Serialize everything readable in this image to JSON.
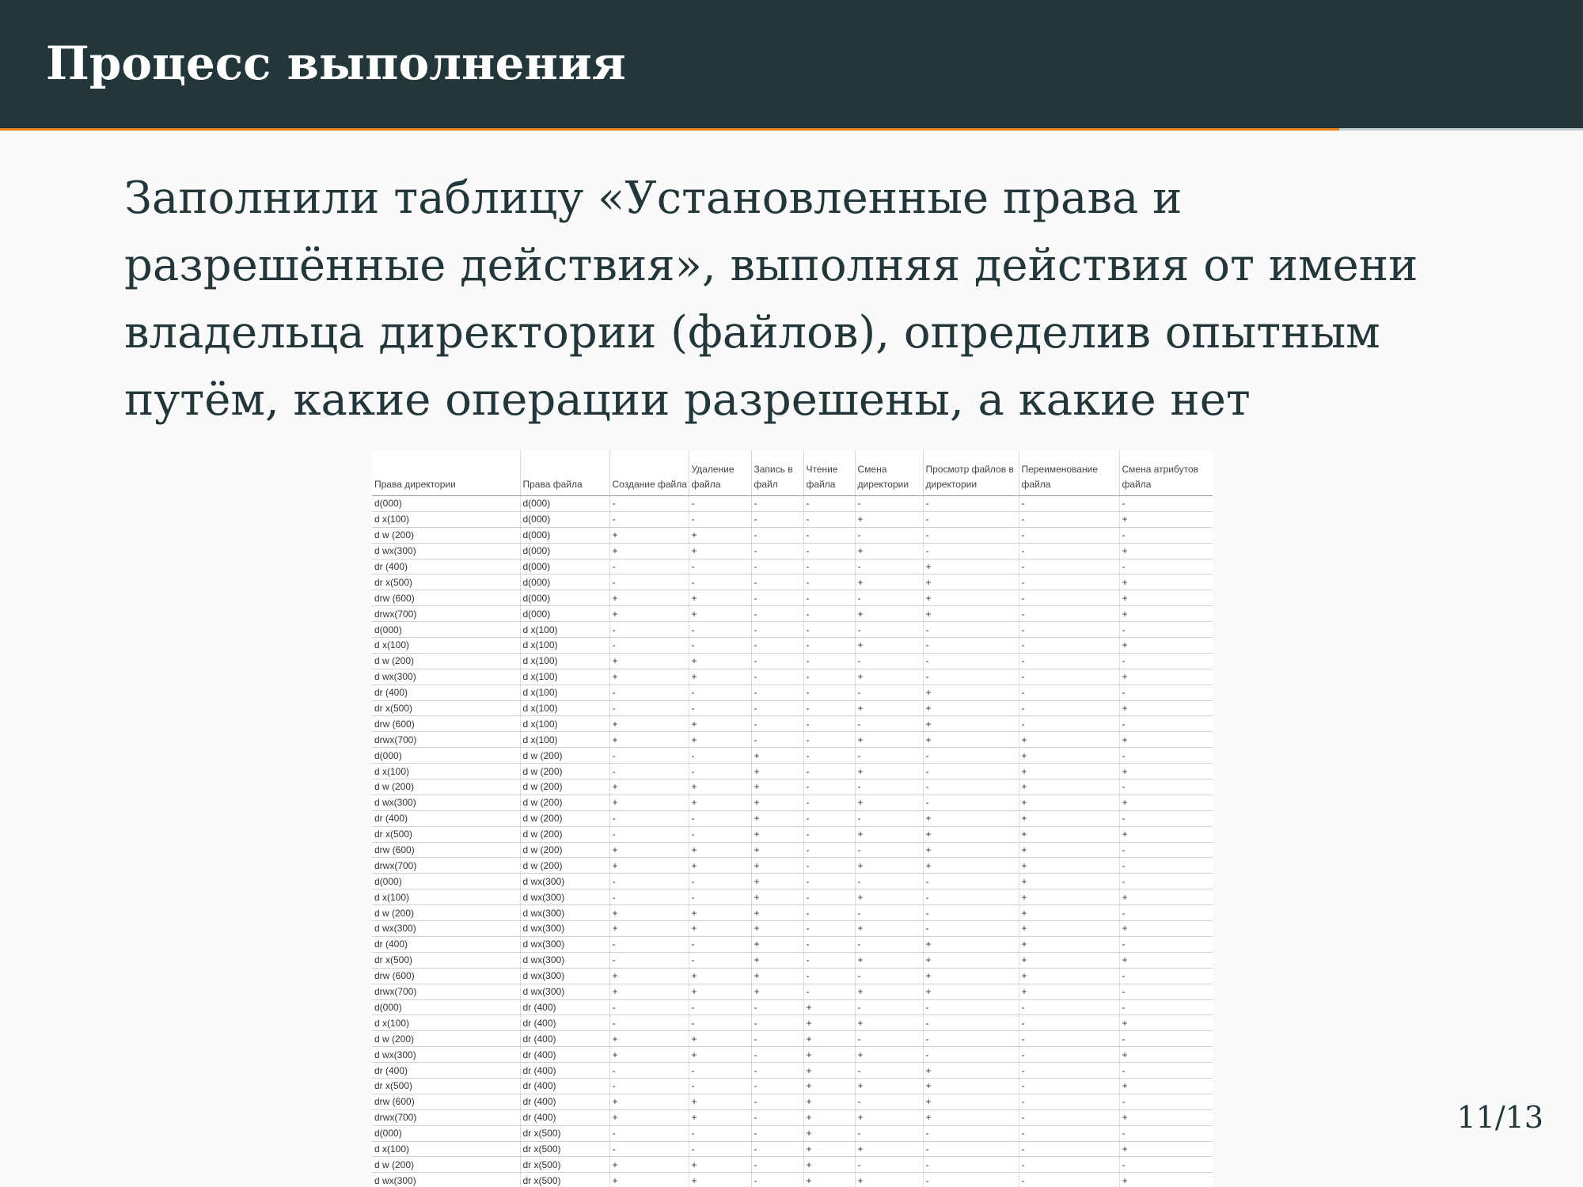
{
  "header": {
    "title": "Процесс выполнения"
  },
  "progress": {
    "fraction": 0.846
  },
  "body": {
    "text": "Заполнили таблицу «Установленные права и разрешённые действия», выполняя действия от имени владельца директории (файлов), определив опытным путём, какие операции разрешены, а какие нет"
  },
  "table": {
    "columns": [
      "Права директории",
      "Права файла",
      "Создание файла",
      "Удаление файла",
      "Запись в файл",
      "Чтение файла",
      "Смена директории",
      "Просмотр файлов в директории",
      "Переименование файла",
      "Смена атрибутов файла"
    ],
    "rows": [
      [
        "d(000)",
        "d(000)",
        "-",
        "-",
        "-",
        "-",
        "-",
        "-",
        "-",
        "-"
      ],
      [
        "d x(100)",
        "d(000)",
        "-",
        "-",
        "-",
        "-",
        "+",
        "-",
        "-",
        "+"
      ],
      [
        "d w (200)",
        "d(000)",
        "+",
        "+",
        "-",
        "-",
        "-",
        "-",
        "-",
        "-"
      ],
      [
        "d wx(300)",
        "d(000)",
        "+",
        "+",
        "-",
        "-",
        "+",
        "-",
        "-",
        "+"
      ],
      [
        "dr (400)",
        "d(000)",
        "-",
        "-",
        "-",
        "-",
        "-",
        "+",
        "-",
        "-"
      ],
      [
        "dr x(500)",
        "d(000)",
        "-",
        "-",
        "-",
        "-",
        "+",
        "+",
        "-",
        "+"
      ],
      [
        "drw (600)",
        "d(000)",
        "+",
        "+",
        "-",
        "-",
        "-",
        "+",
        "-",
        "+"
      ],
      [
        "drwx(700)",
        "d(000)",
        "+",
        "+",
        "-",
        "-",
        "+",
        "+",
        "-",
        "+"
      ],
      [
        "d(000)",
        "d x(100)",
        "-",
        "-",
        "-",
        "-",
        "-",
        "-",
        "-",
        "-"
      ],
      [
        "d x(100)",
        "d x(100)",
        "-",
        "-",
        "-",
        "-",
        "+",
        "-",
        "-",
        "+"
      ],
      [
        "d w (200)",
        "d x(100)",
        "+",
        "+",
        "-",
        "-",
        "-",
        "-",
        "-",
        "-"
      ],
      [
        "d wx(300)",
        "d x(100)",
        "+",
        "+",
        "-",
        "-",
        "+",
        "-",
        "-",
        "+"
      ],
      [
        "dr (400)",
        "d x(100)",
        "-",
        "-",
        "-",
        "-",
        "-",
        "+",
        "-",
        "-"
      ],
      [
        "dr x(500)",
        "d x(100)",
        "-",
        "-",
        "-",
        "-",
        "+",
        "+",
        "-",
        "+"
      ],
      [
        "drw (600)",
        "d x(100)",
        "+",
        "+",
        "-",
        "-",
        "-",
        "+",
        "-",
        "-"
      ],
      [
        "drwx(700)",
        "d x(100)",
        "+",
        "+",
        "-",
        "-",
        "+",
        "+",
        "+",
        "+"
      ],
      [
        "d(000)",
        "d w (200)",
        "-",
        "-",
        "+",
        "-",
        "-",
        "-",
        "+",
        "-"
      ],
      [
        "d x(100)",
        "d w (200)",
        "-",
        "-",
        "+",
        "-",
        "+",
        "-",
        "+",
        "+"
      ],
      [
        "d w (200)",
        "d w (200)",
        "+",
        "+",
        "+",
        "-",
        "-",
        "-",
        "+",
        "-"
      ],
      [
        "d wx(300)",
        "d w (200)",
        "+",
        "+",
        "+",
        "-",
        "+",
        "-",
        "+",
        "+"
      ],
      [
        "dr (400)",
        "d w (200)",
        "-",
        "-",
        "+",
        "-",
        "-",
        "+",
        "+",
        "-"
      ],
      [
        "dr x(500)",
        "d w (200)",
        "-",
        "-",
        "+",
        "-",
        "+",
        "+",
        "+",
        "+"
      ],
      [
        "drw (600)",
        "d w (200)",
        "+",
        "+",
        "+",
        "-",
        "-",
        "+",
        "+",
        "-"
      ],
      [
        "drwx(700)",
        "d w (200)",
        "+",
        "+",
        "+",
        "-",
        "+",
        "+",
        "+",
        "-"
      ],
      [
        "d(000)",
        "d wx(300)",
        "-",
        "-",
        "+",
        "-",
        "-",
        "-",
        "+",
        "-"
      ],
      [
        "d x(100)",
        "d wx(300)",
        "-",
        "-",
        "+",
        "-",
        "+",
        "-",
        "+",
        "+"
      ],
      [
        "d w (200)",
        "d wx(300)",
        "+",
        "+",
        "+",
        "-",
        "-",
        "-",
        "+",
        "-"
      ],
      [
        "d wx(300)",
        "d wx(300)",
        "+",
        "+",
        "+",
        "-",
        "+",
        "-",
        "+",
        "+"
      ],
      [
        "dr (400)",
        "d wx(300)",
        "-",
        "-",
        "+",
        "-",
        "-",
        "+",
        "+",
        "-"
      ],
      [
        "dr x(500)",
        "d wx(300)",
        "-",
        "-",
        "+",
        "-",
        "+",
        "+",
        "+",
        "+"
      ],
      [
        "drw (600)",
        "d wx(300)",
        "+",
        "+",
        "+",
        "-",
        "-",
        "+",
        "+",
        "-"
      ],
      [
        "drwx(700)",
        "d wx(300)",
        "+",
        "+",
        "+",
        "-",
        "+",
        "+",
        "+",
        "-"
      ],
      [
        "d(000)",
        "dr (400)",
        "-",
        "-",
        "-",
        "+",
        "-",
        "-",
        "-",
        "-"
      ],
      [
        "d x(100)",
        "dr (400)",
        "-",
        "-",
        "-",
        "+",
        "+",
        "-",
        "-",
        "+"
      ],
      [
        "d w (200)",
        "dr (400)",
        "+",
        "+",
        "-",
        "+",
        "-",
        "-",
        "-",
        "-"
      ],
      [
        "d wx(300)",
        "dr (400)",
        "+",
        "+",
        "-",
        "+",
        "+",
        "-",
        "-",
        "+"
      ],
      [
        "dr (400)",
        "dr (400)",
        "-",
        "-",
        "-",
        "+",
        "-",
        "+",
        "-",
        "-"
      ],
      [
        "dr x(500)",
        "dr (400)",
        "-",
        "-",
        "-",
        "+",
        "+",
        "+",
        "-",
        "+"
      ],
      [
        "drw (600)",
        "dr (400)",
        "+",
        "+",
        "-",
        "+",
        "-",
        "+",
        "-",
        "-"
      ],
      [
        "drwx(700)",
        "dr (400)",
        "+",
        "+",
        "-",
        "+",
        "+",
        "+",
        "-",
        "+"
      ],
      [
        "d(000)",
        "dr x(500)",
        "-",
        "-",
        "-",
        "+",
        "-",
        "-",
        "-",
        "-"
      ],
      [
        "d x(100)",
        "dr x(500)",
        "-",
        "-",
        "-",
        "+",
        "+",
        "-",
        "-",
        "+"
      ],
      [
        "d w (200)",
        "dr x(500)",
        "+",
        "+",
        "-",
        "+",
        "-",
        "-",
        "-",
        "-"
      ],
      [
        "d wx(300)",
        "dr x(500)",
        "+",
        "+",
        "-",
        "+",
        "+",
        "-",
        "-",
        "+"
      ]
    ]
  },
  "footer": {
    "page": "11/13"
  }
}
